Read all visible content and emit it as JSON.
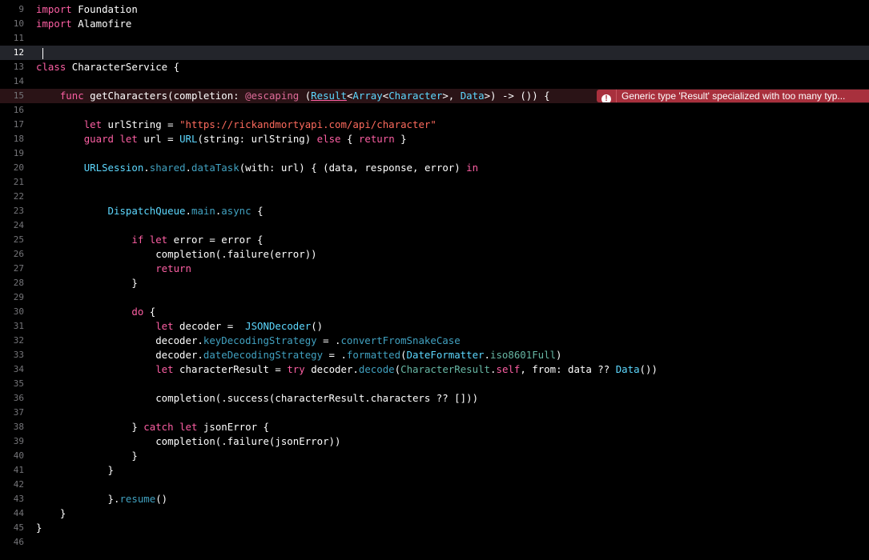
{
  "editor": {
    "language": "Swift",
    "current_line": 12,
    "error": {
      "line": 15,
      "icon": "error-icon",
      "message": "Generic type 'Result' specialized with too many typ..."
    },
    "colors": {
      "background": "#000000",
      "keyword": "#fc5fa3",
      "string": "#fc6a5d",
      "type": "#5dd8ff",
      "function": "#41a1c0",
      "project_symbol": "#67b7a4",
      "line_number": "#747478",
      "error_banner": "#a8303d"
    },
    "lines": [
      {
        "num": "9",
        "tokens": [
          [
            "kw",
            "import"
          ],
          [
            "plain",
            " Foundation"
          ]
        ]
      },
      {
        "num": "10",
        "tokens": [
          [
            "kw",
            "import"
          ],
          [
            "plain",
            " Alamofire"
          ]
        ]
      },
      {
        "num": "11",
        "tokens": []
      },
      {
        "num": "12",
        "tokens": []
      },
      {
        "num": "13",
        "tokens": [
          [
            "kw",
            "class"
          ],
          [
            "plain",
            " CharacterService {"
          ]
        ]
      },
      {
        "num": "14",
        "tokens": []
      },
      {
        "num": "15",
        "tokens": [
          [
            "plain",
            "    "
          ],
          [
            "kw",
            "func"
          ],
          [
            "plain",
            " getCharacters(completion: "
          ],
          [
            "attr",
            "@escaping"
          ],
          [
            "plain",
            " ("
          ],
          [
            "type-ul",
            "Result"
          ],
          [
            "plain",
            "<"
          ],
          [
            "type",
            "Array"
          ],
          [
            "plain",
            "<"
          ],
          [
            "type",
            "Character"
          ],
          [
            "plain",
            ">, "
          ],
          [
            "type",
            "Data"
          ],
          [
            "plain",
            ">) -> ()) {"
          ]
        ]
      },
      {
        "num": "16",
        "tokens": []
      },
      {
        "num": "17",
        "tokens": [
          [
            "plain",
            "        "
          ],
          [
            "kw",
            "let"
          ],
          [
            "plain",
            " urlString = "
          ],
          [
            "str",
            "\"https://rickandmortyapi.com/api/character\""
          ]
        ]
      },
      {
        "num": "18",
        "tokens": [
          [
            "plain",
            "        "
          ],
          [
            "kw",
            "guard"
          ],
          [
            "plain",
            " "
          ],
          [
            "kw",
            "let"
          ],
          [
            "plain",
            " url = "
          ],
          [
            "type",
            "URL"
          ],
          [
            "plain",
            "(string: urlString) "
          ],
          [
            "kw",
            "else"
          ],
          [
            "plain",
            " { "
          ],
          [
            "kw",
            "return"
          ],
          [
            "plain",
            " }"
          ]
        ]
      },
      {
        "num": "19",
        "tokens": []
      },
      {
        "num": "20",
        "tokens": [
          [
            "plain",
            "        "
          ],
          [
            "type",
            "URLSession"
          ],
          [
            "plain",
            "."
          ],
          [
            "call",
            "shared"
          ],
          [
            "plain",
            "."
          ],
          [
            "call",
            "dataTask"
          ],
          [
            "plain",
            "(with: url) { (data, response, error) "
          ],
          [
            "kw",
            "in"
          ]
        ]
      },
      {
        "num": "21",
        "tokens": []
      },
      {
        "num": "22",
        "tokens": []
      },
      {
        "num": "23",
        "tokens": [
          [
            "plain",
            "            "
          ],
          [
            "type",
            "DispatchQueue"
          ],
          [
            "plain",
            "."
          ],
          [
            "call",
            "main"
          ],
          [
            "plain",
            "."
          ],
          [
            "call",
            "async"
          ],
          [
            "plain",
            " {"
          ]
        ]
      },
      {
        "num": "24",
        "tokens": []
      },
      {
        "num": "25",
        "tokens": [
          [
            "plain",
            "                "
          ],
          [
            "kw",
            "if"
          ],
          [
            "plain",
            " "
          ],
          [
            "kw",
            "let"
          ],
          [
            "plain",
            " error = error {"
          ]
        ]
      },
      {
        "num": "26",
        "tokens": [
          [
            "plain",
            "                    completion(.failure(error))"
          ]
        ]
      },
      {
        "num": "27",
        "tokens": [
          [
            "plain",
            "                    "
          ],
          [
            "kw",
            "return"
          ]
        ]
      },
      {
        "num": "28",
        "tokens": [
          [
            "plain",
            "                }"
          ]
        ]
      },
      {
        "num": "29",
        "tokens": []
      },
      {
        "num": "30",
        "tokens": [
          [
            "plain",
            "                "
          ],
          [
            "kw",
            "do"
          ],
          [
            "plain",
            " {"
          ]
        ]
      },
      {
        "num": "31",
        "tokens": [
          [
            "plain",
            "                    "
          ],
          [
            "kw",
            "let"
          ],
          [
            "plain",
            " decoder =  "
          ],
          [
            "type",
            "JSONDecoder"
          ],
          [
            "plain",
            "()"
          ]
        ]
      },
      {
        "num": "32",
        "tokens": [
          [
            "plain",
            "                    decoder."
          ],
          [
            "call",
            "keyDecodingStrategy"
          ],
          [
            "plain",
            " = ."
          ],
          [
            "call",
            "convertFromSnakeCase"
          ]
        ]
      },
      {
        "num": "33",
        "tokens": [
          [
            "plain",
            "                    decoder."
          ],
          [
            "call",
            "dateDecodingStrategy"
          ],
          [
            "plain",
            " = ."
          ],
          [
            "call",
            "formatted"
          ],
          [
            "plain",
            "("
          ],
          [
            "type",
            "DateFormatter"
          ],
          [
            "plain",
            "."
          ],
          [
            "proj",
            "iso8601Full"
          ],
          [
            "plain",
            ")"
          ]
        ]
      },
      {
        "num": "34",
        "tokens": [
          [
            "plain",
            "                    "
          ],
          [
            "kw",
            "let"
          ],
          [
            "plain",
            " characterResult = "
          ],
          [
            "kw",
            "try"
          ],
          [
            "plain",
            " decoder."
          ],
          [
            "call",
            "decode"
          ],
          [
            "plain",
            "("
          ],
          [
            "proj",
            "CharacterResult"
          ],
          [
            "plain",
            "."
          ],
          [
            "kw",
            "self"
          ],
          [
            "plain",
            ", from: data ?? "
          ],
          [
            "type",
            "Data"
          ],
          [
            "plain",
            "())"
          ]
        ]
      },
      {
        "num": "35",
        "tokens": []
      },
      {
        "num": "36",
        "tokens": [
          [
            "plain",
            "                    completion(.success(characterResult.characters ?? []))"
          ]
        ]
      },
      {
        "num": "37",
        "tokens": []
      },
      {
        "num": "38",
        "tokens": [
          [
            "plain",
            "                } "
          ],
          [
            "kw",
            "catch"
          ],
          [
            "plain",
            " "
          ],
          [
            "kw",
            "let"
          ],
          [
            "plain",
            " jsonError {"
          ]
        ]
      },
      {
        "num": "39",
        "tokens": [
          [
            "plain",
            "                    completion(.failure(jsonError))"
          ]
        ]
      },
      {
        "num": "40",
        "tokens": [
          [
            "plain",
            "                }"
          ]
        ]
      },
      {
        "num": "41",
        "tokens": [
          [
            "plain",
            "            }"
          ]
        ]
      },
      {
        "num": "42",
        "tokens": []
      },
      {
        "num": "43",
        "tokens": [
          [
            "plain",
            "            }."
          ],
          [
            "call",
            "resume"
          ],
          [
            "plain",
            "()"
          ]
        ]
      },
      {
        "num": "44",
        "tokens": [
          [
            "plain",
            "    }"
          ]
        ]
      },
      {
        "num": "45",
        "tokens": [
          [
            "plain",
            "}"
          ]
        ]
      },
      {
        "num": "46",
        "tokens": []
      }
    ]
  }
}
